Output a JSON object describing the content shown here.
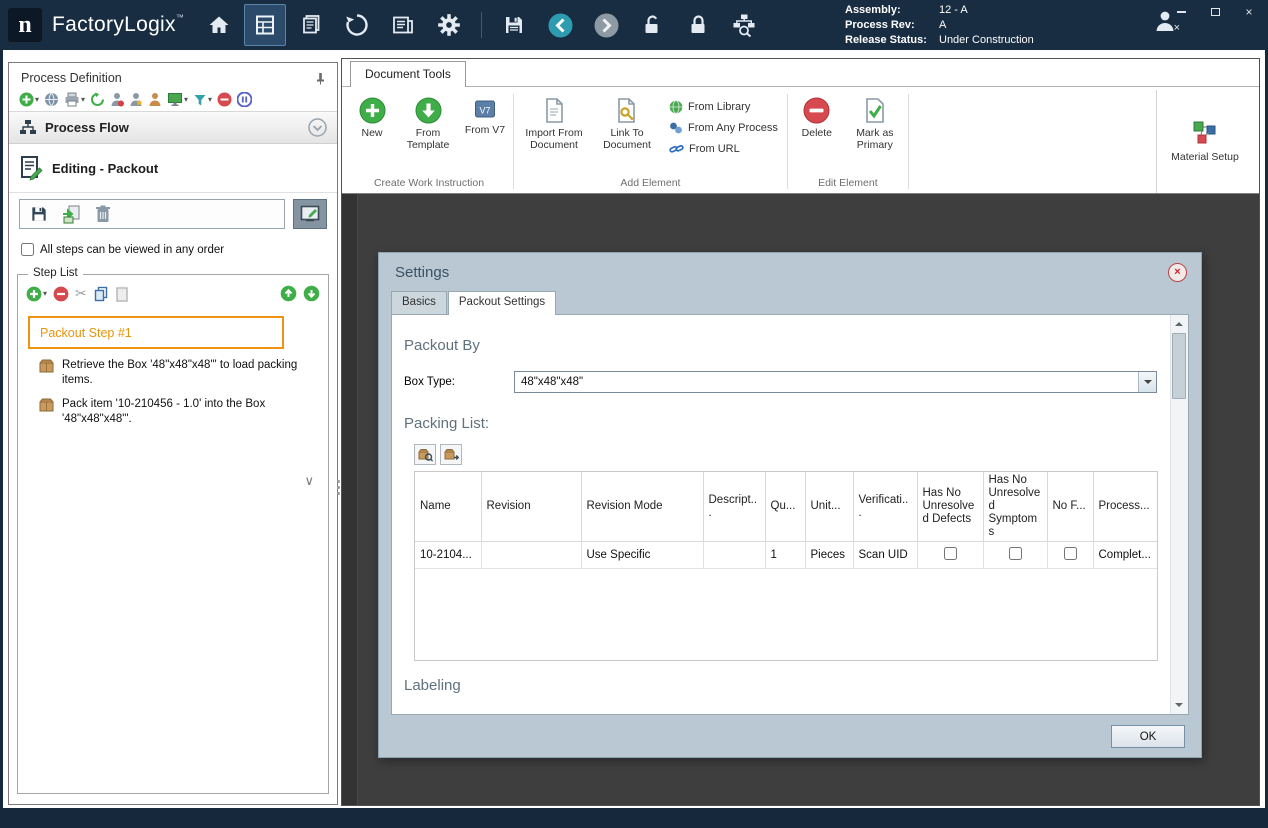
{
  "titlebar": {
    "logo_letter": "n",
    "app_name": "FactoryLogix",
    "trademark": "™",
    "info": {
      "assembly_label": "Assembly:",
      "assembly_value": "12 - A",
      "process_rev_label": "Process Rev:",
      "process_rev_value": "A",
      "release_status_label": "Release Status:",
      "release_status_value": "Under Construction"
    }
  },
  "left_panel": {
    "title": "Process Definition",
    "process_flow": "Process Flow",
    "editing": "Editing - Packout",
    "order_checkbox_label": "All steps can be viewed in any order",
    "step_list": {
      "title": "Step List",
      "selected_step": "Packout Step #1",
      "steps": [
        "Retrieve the Box '48\"x48\"x48\"' to load packing items.",
        "Pack item '10-210456 - 1.0' into the Box '48\"x48\"x48\"'."
      ]
    }
  },
  "ribbon": {
    "tab": "Document Tools",
    "create_group": {
      "label": "Create Work Instruction",
      "new": "New",
      "from_template": "From Template",
      "from_v7": "From V7"
    },
    "add_group": {
      "label": "Add Element",
      "import_from_document": "Import From Document",
      "link_to_document": "Link To Document",
      "from_library": "From Library",
      "from_any_process": "From Any Process",
      "from_url": "From URL"
    },
    "edit_group": {
      "label": "Edit Element",
      "delete": "Delete",
      "mark_as_primary": "Mark as Primary"
    },
    "material_setup": "Material Setup"
  },
  "dialog": {
    "title": "Settings",
    "tabs": [
      "Basics",
      "Packout Settings"
    ],
    "packout_by": "Packout By",
    "box_type_label": "Box Type:",
    "box_type_value": "48\"x48\"x48\"",
    "packing_list": "Packing List:",
    "table": {
      "columns": [
        "Name",
        "Revision",
        "Revision Mode",
        "Descript...",
        "Qu...",
        "Unit...",
        "Verificati...",
        "Has No Unresolved Defects",
        "Has No Unresolved Symptoms",
        "No F...",
        "Process..."
      ],
      "rows": [
        {
          "name": "10-2104...",
          "revision": "",
          "revision_mode": "Use Specific",
          "description": "",
          "quantity": "1",
          "unit": "Pieces",
          "verification": "Scan UID",
          "has_no_unresolved_defects": false,
          "has_no_unresolved_symptoms": false,
          "no_f": false,
          "process": "Complet..."
        }
      ]
    },
    "labeling": "Labeling",
    "ok": "OK"
  },
  "icons": {
    "cut_glyph": "✂",
    "chevron_down_glyph": "∨",
    "caret_glyph": "▾",
    "close_glyph": "×"
  },
  "colors": {
    "titlebar": "#182c42",
    "accent_orange": "#e8930c",
    "dialog_frame": "#b9c8d2",
    "surface_dark": "#3e3e3e",
    "green": "#3fae49",
    "red": "#d6494f"
  }
}
